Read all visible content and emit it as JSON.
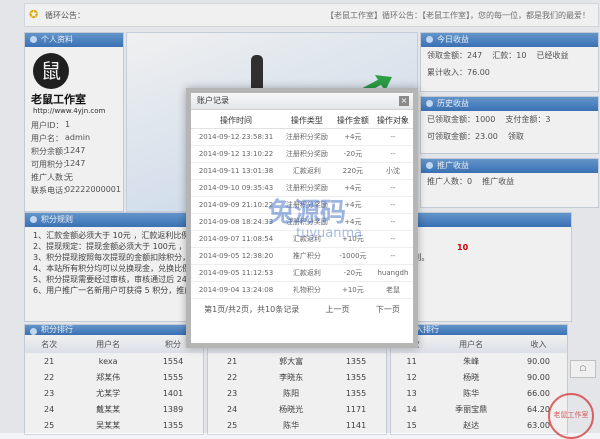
{
  "notice": {
    "label": "循环公告：",
    "text": "【老鼠工作室】循环公告：【老鼠工作室】，您的每一位，都是我们的最爱！"
  },
  "profile": {
    "title": "个人资料",
    "brand": "老鼠工作室",
    "url": "http://www.4yjn.com",
    "rows": [
      {
        "k": "用户ID：",
        "v": "1"
      },
      {
        "k": "用户名：",
        "v": "admin"
      },
      {
        "k": "积分余额：",
        "v": "1247"
      },
      {
        "k": "可用积分：",
        "v": "1247"
      },
      {
        "k": "推广人数：",
        "v": "无"
      },
      {
        "k": "联系电话：",
        "v": "02222000001"
      }
    ]
  },
  "stats": {
    "title1": "今日收益",
    "row1": [
      "领取金额：247",
      "汇款：10",
      "已经收益"
    ],
    "row2": [
      "累计收入：76.00"
    ],
    "title2": "历史收益",
    "row3": [
      "已领取金额：1000",
      "支付金额：3"
    ],
    "row4": [
      "可领取金额：23.00",
      "领取"
    ],
    "title3": "推广收益",
    "row5": [
      "推广人数：0",
      "推广收益"
    ]
  },
  "rules": {
    "title": "积分规则",
    "lines": [
      "1、汇款金额必须大于 10元 ，汇款返利比例为 10% 。",
      "2、提现规定：提现金额必须大于 100元 ，每次提现需支付 1元 手续费。",
      "3、积分提现按照每次提现的金额扣除积分，每次提现必须在 10个工作日 内完成，每次提现积分都要符合规则。",
      "4、本站所有积分均可以兑换现金，兑换比例 1:1 ，最低兑换额度 10 元 。",
      "5、积分提现需要经过审核，审核通过后 24小时 内到账，提现申请提交后不可撤销。",
      "6、用户推广一名新用户可获得 5 积分，推广用户每次充值可获得 5% 的积分奖励。"
    ],
    "highlight": "10"
  },
  "modal": {
    "title": "账户记录",
    "headers": [
      "操作时间",
      "操作类型",
      "操作金额",
      "操作对象"
    ],
    "rows": [
      [
        "2014-09-12 23:58:31",
        "注册积分奖励",
        "+4元",
        "--"
      ],
      [
        "2014-09-12 13:10:22",
        "注册积分奖励",
        "-20元",
        "--"
      ],
      [
        "2014-09-11 13:01:38",
        "汇款返利",
        "220元",
        "小沈"
      ],
      [
        "2014-09-10 09:35:43",
        "注册积分奖励",
        "+4元",
        "--"
      ],
      [
        "2014-09-09 21:10:22",
        "注册积分奖励",
        "+4元",
        "--"
      ],
      [
        "2014-09-08 18:24:33",
        "注册积分奖励",
        "+4元",
        "--"
      ],
      [
        "2014-09-07 11:08:54",
        "汇款返利",
        "+10元",
        "--"
      ],
      [
        "2014-09-05 12:38:20",
        "推广积分",
        "-1000元",
        "--"
      ],
      [
        "2014-09-05 11:12:53",
        "汇款返利",
        "-20元",
        "huangdh"
      ],
      [
        "2014-09-04 13:24:08",
        "礼物积分",
        "+10元",
        "老鼠"
      ]
    ],
    "pager": [
      "第1页/共2页，共10条记录",
      "上一页",
      "下一页"
    ],
    "close": "×"
  },
  "ranks": [
    {
      "headers": [
        "名次",
        "用户名",
        "积分"
      ],
      "rows": [
        [
          "21",
          "kexa",
          "1554"
        ],
        [
          "22",
          "郑某伟",
          "1555"
        ],
        [
          "23",
          "尤某学",
          "1401"
        ],
        [
          "24",
          "戴某某",
          "1389"
        ],
        [
          "25",
          "吴某某",
          "1355"
        ]
      ]
    },
    {
      "headers": [
        "名次",
        "用户名",
        "分数"
      ],
      "rows": [
        [
          "21",
          "郭大富",
          "1355"
        ],
        [
          "22",
          "李晓东",
          "1355"
        ],
        [
          "23",
          "陈阳",
          "1355"
        ],
        [
          "24",
          "杨晓光",
          "1171"
        ],
        [
          "25",
          "陈华",
          "1141"
        ]
      ]
    },
    {
      "headers": [
        "名次",
        "用户名",
        "收入"
      ],
      "rows": [
        [
          "11",
          "朱峰",
          "90.00"
        ],
        [
          "12",
          "杨晓",
          "90.00"
        ],
        [
          "13",
          "陈华",
          "66.00"
        ],
        [
          "14",
          "季丽宝鼎",
          "64.20"
        ],
        [
          "15",
          "赵达",
          "63.00"
        ]
      ]
    }
  ],
  "rank_titles": [
    "积分排行",
    "",
    "收入排行"
  ],
  "watermark": {
    "cn": "兔源码",
    "en": "tuyuanma"
  },
  "seal": "老鼠工作室",
  "side_btn": "☖"
}
